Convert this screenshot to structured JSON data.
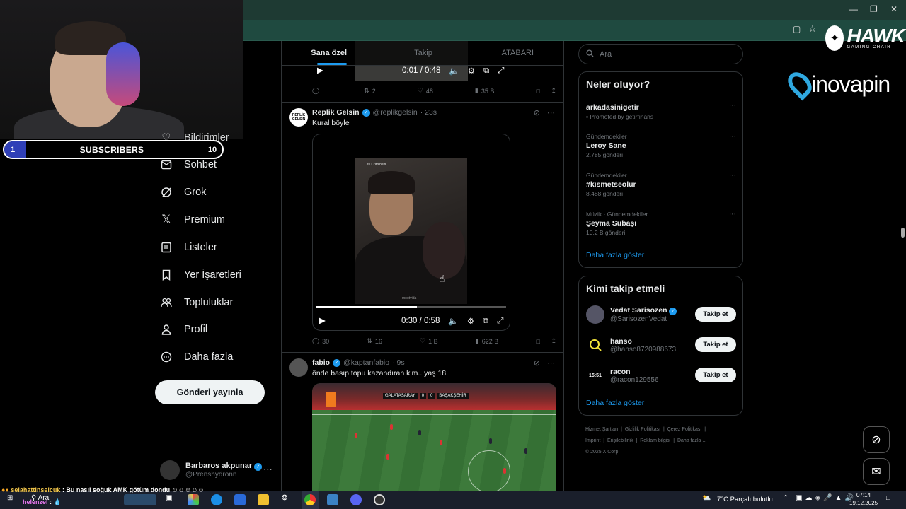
{
  "overlay": {
    "subscribers": {
      "current": "1",
      "label": "SUBSCRIBERS",
      "goal": "10",
      "progress": 0.1
    },
    "hawk": {
      "brand": "HAWK",
      "tagline": "GAMING CHAIR"
    },
    "inovapin": {
      "brand": "inovapin"
    },
    "chat": [
      {
        "user": "selahattinselcuk",
        "message": ": Bu nasıl soğuk AMK götüm dondu"
      },
      {
        "user": "helenzel",
        "message": ":"
      }
    ]
  },
  "nav": {
    "partial_item": "Bildirimler",
    "items": [
      {
        "label": "Sohbet",
        "icon": "chat-icon"
      },
      {
        "label": "Grok",
        "icon": "grok-icon"
      },
      {
        "label": "Premium",
        "icon": "x-logo-icon"
      },
      {
        "label": "Listeler",
        "icon": "list-icon"
      },
      {
        "label": "Yer İşaretleri",
        "icon": "bookmark-icon"
      },
      {
        "label": "Topluluklar",
        "icon": "communities-icon"
      },
      {
        "label": "Profil",
        "icon": "profile-icon"
      },
      {
        "label": "Daha fazla",
        "icon": "more-circle-icon"
      }
    ],
    "post_button": "Gönderi yayınla",
    "account": {
      "name": "Barbaros akpunar",
      "handle": "@Prenshydronn"
    }
  },
  "timeline": {
    "tabs": [
      {
        "label": "Sana özel",
        "active": true
      },
      {
        "label": "Takip",
        "active": false
      },
      {
        "label": "ATABARI",
        "active": false
      }
    ],
    "prev_post": {
      "video_time": "0:01 / 0:48",
      "replies": "",
      "retweets": "2",
      "likes": "48",
      "views": "35 B"
    },
    "posts": [
      {
        "name": "Replik Gelsin",
        "avatar_text": "REPLİK GELSİN",
        "handle": "@replikgelsin",
        "time": "· 23s",
        "text": "Kural böyle",
        "video": {
          "time": "0:30 / 0:58",
          "progress": 0.53,
          "title_overlay": "Les Criminels",
          "watermark": "mootvida"
        },
        "replies": "30",
        "retweets": "16",
        "likes": "1 B",
        "views": "622 B"
      },
      {
        "name": "fabio",
        "handle": "@kaptanfabio",
        "time": "· 9s",
        "text": "önde basıp topu kazandıran kim.. yaş 18..",
        "scorebug": {
          "home": "GALATASARAY",
          "home_score": "0",
          "away_score": "0",
          "away": "BAŞAKŞEHİR"
        }
      }
    ]
  },
  "sidebar": {
    "search_placeholder": "Ara",
    "trends_title": "Neler oluyor?",
    "trends": [
      {
        "meta": "",
        "name": "arkadasinigetir",
        "count": "Promoted by getirfinans",
        "promoted": true
      },
      {
        "meta": "Gündemdekiler",
        "name": "Leroy Sane",
        "count": "2.785 gönderi"
      },
      {
        "meta": "Gündemdekiler",
        "name": "#kısmetseolur",
        "count": "8.488 gönderi"
      },
      {
        "meta": "Müzik · Gündemdekiler",
        "name": "Şeyma Subaşı",
        "count": "10,2 B gönderi"
      }
    ],
    "trends_more": "Daha fazla göster",
    "who_title": "Kimi takip etmeli",
    "who": [
      {
        "name": "Vedat Sarisozen",
        "handle": "@SarisozenVedat",
        "verified": true,
        "button": "Takip et"
      },
      {
        "name": "hanso",
        "handle": "@hanso8720988673",
        "verified": false,
        "button": "Takip et"
      },
      {
        "name": "racon",
        "handle": "@racon129556",
        "avatar_text": "15:51",
        "verified": false,
        "button": "Takip et"
      }
    ],
    "who_more": "Daha fazla göster",
    "footer": [
      "Hizmet Şartları",
      "Gizlilik Politikası",
      "Çerez Politikası",
      "Imprint",
      "Erişilebilirlik",
      "Reklam bilgisi",
      "Daha fazla ...",
      "© 2025 X Corp."
    ]
  },
  "taskbar": {
    "search_label": "Ara",
    "weather": "7°C  Parçalı bulutlu",
    "time": "07:14",
    "date": "19.12.2025"
  },
  "colors": {
    "accent": "#1d9bf0",
    "chrome": "#1f4a40",
    "subs_fill": "#2f3fb7"
  }
}
